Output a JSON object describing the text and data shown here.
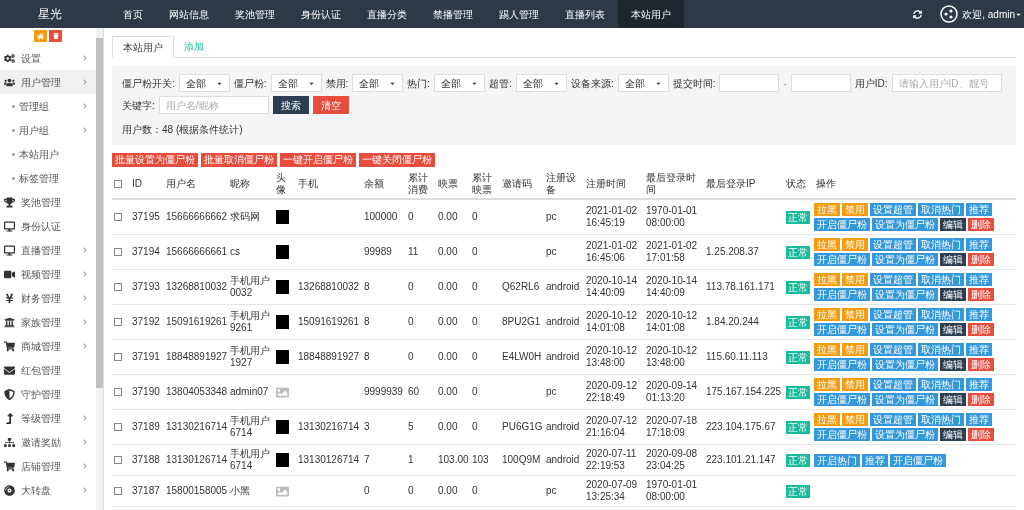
{
  "brand": "星光",
  "nav": [
    {
      "label": "首页",
      "selected": false
    },
    {
      "label": "网站信息",
      "selected": false
    },
    {
      "label": "奖池管理",
      "selected": false
    },
    {
      "label": "身份认证",
      "selected": false
    },
    {
      "label": "直播分类",
      "selected": false
    },
    {
      "label": "禁播管理",
      "selected": false
    },
    {
      "label": "踢人管理",
      "selected": false
    },
    {
      "label": "直播列表",
      "selected": false
    },
    {
      "label": "本站用户",
      "selected": true
    }
  ],
  "user_menu": {
    "label": "欢迎, admin"
  },
  "sidebar": {
    "items": [
      {
        "label": "设置",
        "has_submenu": true,
        "selected": false
      },
      {
        "label": "用户管理",
        "has_submenu": true,
        "selected": true,
        "children": [
          {
            "label": "管理组",
            "has_submenu": true,
            "selected": false
          },
          {
            "label": "用户组",
            "has_submenu": true,
            "selected": false
          },
          {
            "label": "本站用户",
            "has_submenu": false,
            "selected": false
          },
          {
            "label": "标签管理",
            "has_submenu": false,
            "selected": false
          }
        ]
      },
      {
        "label": "奖池管理",
        "has_submenu": false,
        "selected": false
      },
      {
        "label": "身份认证",
        "has_submenu": false,
        "selected": false
      },
      {
        "label": "直播管理",
        "has_submenu": true,
        "selected": false
      },
      {
        "label": "视频管理",
        "has_submenu": true,
        "selected": false
      },
      {
        "label": "财务管理",
        "has_submenu": true,
        "selected": false
      },
      {
        "label": "家族管理",
        "has_submenu": true,
        "selected": false
      },
      {
        "label": "商城管理",
        "has_submenu": true,
        "selected": false
      },
      {
        "label": "红包管理",
        "has_submenu": false,
        "selected": false
      },
      {
        "label": "守护管理",
        "has_submenu": false,
        "selected": false
      },
      {
        "label": "等级管理",
        "has_submenu": true,
        "selected": false
      },
      {
        "label": "邀请奖励",
        "has_submenu": true,
        "selected": false
      },
      {
        "label": "店铺管理",
        "has_submenu": true,
        "selected": false
      },
      {
        "label": "大转盘",
        "has_submenu": true,
        "selected": false
      }
    ]
  },
  "tabs": [
    {
      "label": "本站用户",
      "selected": true
    },
    {
      "label": "添加",
      "selected": false
    }
  ],
  "filters": [
    {
      "kind": "select",
      "label": "僵尸粉开关:",
      "value": "全部"
    },
    {
      "kind": "select",
      "label": "僵尸粉:",
      "value": "全部"
    },
    {
      "kind": "select",
      "label": "禁用:",
      "value": "全部"
    },
    {
      "kind": "select",
      "label": "热门:",
      "value": "全部"
    },
    {
      "kind": "select",
      "label": "超管:",
      "value": "全部"
    },
    {
      "kind": "select",
      "label": "设备来源:",
      "value": "全部"
    },
    {
      "kind": "daterange",
      "label": "提交时间:",
      "separator": "-"
    },
    {
      "kind": "text",
      "label": "用户ID:",
      "placeholder": "请输入用户ID、靓号"
    },
    {
      "kind": "text",
      "label": "关键字:",
      "placeholder": "用户名/昵称"
    }
  ],
  "search_button": "搜索",
  "clear_button": "清空",
  "count_text": "用户数：48 (根据条件统计)",
  "bulk_buttons": [
    "批量设置为僵尸粉",
    "批量取消僵尸粉",
    "一键开启僵尸粉",
    "一键关闭僵尸粉"
  ],
  "table": {
    "select_all_checked": false,
    "columns": [
      "ID",
      "用户名",
      "昵称",
      "头像",
      "手机",
      "余额",
      "累计消费",
      "映票",
      "累计映票",
      "邀请码",
      "注册设备",
      "注册时间",
      "最后登录时间",
      "最后登录IP",
      "状态",
      "操作"
    ],
    "rows": [
      {
        "checked": false,
        "id": "37195",
        "username": "15666666662",
        "nickname": "求码网",
        "avatar": {
          "kind": "image"
        },
        "phone": "",
        "balance": "100000",
        "consumed": "0",
        "tickets": "0.00",
        "total_tickets": "0",
        "invite_code": "",
        "device": "pc",
        "reg_time": "2021-01-02 16:45:19",
        "last_login": "1970-01-01 08:00:00",
        "last_ip": "",
        "status": "正常",
        "actions": [
          {
            "label": "拉黑",
            "kind": "warning"
          },
          {
            "label": "禁用",
            "kind": "warning"
          },
          {
            "label": "设置超管",
            "kind": "info"
          },
          {
            "label": "取消热门",
            "kind": "info"
          },
          {
            "label": "推荐",
            "kind": "info"
          },
          {
            "label": "开启僵尸粉",
            "kind": "info"
          },
          {
            "label": "设置为僵尸粉",
            "kind": "info"
          },
          {
            "label": "编辑",
            "kind": "dark"
          },
          {
            "label": "删除",
            "kind": "danger"
          }
        ]
      },
      {
        "checked": false,
        "id": "37194",
        "username": "15666666661",
        "nickname": "cs",
        "avatar": {
          "kind": "image"
        },
        "phone": "",
        "balance": "99989",
        "consumed": "11",
        "tickets": "0.00",
        "total_tickets": "0",
        "invite_code": "",
        "device": "pc",
        "reg_time": "2021-01-02 16:45:06",
        "last_login": "2021-01-02 17:01:58",
        "last_ip": "1.25.208.37",
        "status": "正常",
        "actions": [
          {
            "label": "拉黑",
            "kind": "warning"
          },
          {
            "label": "禁用",
            "kind": "warning"
          },
          {
            "label": "设置超管",
            "kind": "info"
          },
          {
            "label": "取消热门",
            "kind": "info"
          },
          {
            "label": "推荐",
            "kind": "info"
          },
          {
            "label": "开启僵尸粉",
            "kind": "info"
          },
          {
            "label": "设置为僵尸粉",
            "kind": "info"
          },
          {
            "label": "编辑",
            "kind": "dark"
          },
          {
            "label": "删除",
            "kind": "danger"
          }
        ]
      },
      {
        "checked": false,
        "id": "37193",
        "username": "13268810032",
        "nickname": "手机用户0032",
        "avatar": {
          "kind": "image"
        },
        "phone": "13268810032",
        "balance": "8",
        "consumed": "0",
        "tickets": "0.00",
        "total_tickets": "0",
        "invite_code": "Q62RL6",
        "device": "android",
        "reg_time": "2020-10-14 14:40:09",
        "last_login": "2020-10-14 14:40:09",
        "last_ip": "113.78.161.171",
        "status": "正常",
        "actions": [
          {
            "label": "拉黑",
            "kind": "warning"
          },
          {
            "label": "禁用",
            "kind": "warning"
          },
          {
            "label": "设置超管",
            "kind": "info"
          },
          {
            "label": "取消热门",
            "kind": "info"
          },
          {
            "label": "推荐",
            "kind": "info"
          },
          {
            "label": "开启僵尸粉",
            "kind": "info"
          },
          {
            "label": "设置为僵尸粉",
            "kind": "info"
          },
          {
            "label": "编辑",
            "kind": "dark"
          },
          {
            "label": "删除",
            "kind": "danger"
          }
        ]
      },
      {
        "checked": false,
        "id": "37192",
        "username": "15091619261",
        "nickname": "手机用户9261",
        "avatar": {
          "kind": "image"
        },
        "phone": "15091619261",
        "balance": "8",
        "consumed": "0",
        "tickets": "0.00",
        "total_tickets": "0",
        "invite_code": "8PU2G1",
        "device": "android",
        "reg_time": "2020-10-12 14:01:08",
        "last_login": "2020-10-12 14:01:08",
        "last_ip": "1.84.20.244",
        "status": "正常",
        "actions": [
          {
            "label": "拉黑",
            "kind": "warning"
          },
          {
            "label": "禁用",
            "kind": "warning"
          },
          {
            "label": "设置超管",
            "kind": "info"
          },
          {
            "label": "取消热门",
            "kind": "info"
          },
          {
            "label": "推荐",
            "kind": "info"
          },
          {
            "label": "开启僵尸粉",
            "kind": "info"
          },
          {
            "label": "设置为僵尸粉",
            "kind": "info"
          },
          {
            "label": "编辑",
            "kind": "dark"
          },
          {
            "label": "删除",
            "kind": "danger"
          }
        ]
      },
      {
        "checked": false,
        "id": "37191",
        "username": "18848891927",
        "nickname": "手机用户1927",
        "avatar": {
          "kind": "image"
        },
        "phone": "18848891927",
        "balance": "8",
        "consumed": "0",
        "tickets": "0.00",
        "total_tickets": "0",
        "invite_code": "E4LW0H",
        "device": "android",
        "reg_time": "2020-10-12 13:48:00",
        "last_login": "2020-10-12 13:48:00",
        "last_ip": "115.60.11.113",
        "status": "正常",
        "actions": [
          {
            "label": "拉黑",
            "kind": "warning"
          },
          {
            "label": "禁用",
            "kind": "warning"
          },
          {
            "label": "设置超管",
            "kind": "info"
          },
          {
            "label": "取消热门",
            "kind": "info"
          },
          {
            "label": "推荐",
            "kind": "info"
          },
          {
            "label": "开启僵尸粉",
            "kind": "info"
          },
          {
            "label": "设置为僵尸粉",
            "kind": "info"
          },
          {
            "label": "编辑",
            "kind": "dark"
          },
          {
            "label": "删除",
            "kind": "danger"
          }
        ]
      },
      {
        "checked": false,
        "id": "37190",
        "username": "13804053348",
        "nickname": "admin07",
        "avatar": {
          "kind": "broken"
        },
        "phone": "",
        "balance": "9999939",
        "consumed": "60",
        "tickets": "0.00",
        "total_tickets": "0",
        "invite_code": "",
        "device": "pc",
        "reg_time": "2020-09-12 22:18:49",
        "last_login": "2020-09-14 01:13:20",
        "last_ip": "175.167.154.225",
        "status": "正常",
        "actions": [
          {
            "label": "拉黑",
            "kind": "warning"
          },
          {
            "label": "禁用",
            "kind": "warning"
          },
          {
            "label": "设置超管",
            "kind": "info"
          },
          {
            "label": "取消热门",
            "kind": "info"
          },
          {
            "label": "推荐",
            "kind": "info"
          },
          {
            "label": "开启僵尸粉",
            "kind": "info"
          },
          {
            "label": "设置为僵尸粉",
            "kind": "info"
          },
          {
            "label": "编辑",
            "kind": "dark"
          },
          {
            "label": "删除",
            "kind": "danger"
          }
        ]
      },
      {
        "checked": false,
        "id": "37189",
        "username": "13130216714",
        "nickname": "手机用户6714",
        "avatar": {
          "kind": "image"
        },
        "phone": "13130216714",
        "balance": "3",
        "consumed": "5",
        "tickets": "0.00",
        "total_tickets": "0",
        "invite_code": "PU6G1G",
        "device": "android",
        "reg_time": "2020-07-12 21:16:04",
        "last_login": "2020-07-18 17:18:09",
        "last_ip": "223.104.175.67",
        "status": "正常",
        "actions": [
          {
            "label": "拉黑",
            "kind": "warning"
          },
          {
            "label": "禁用",
            "kind": "warning"
          },
          {
            "label": "设置超管",
            "kind": "info"
          },
          {
            "label": "取消热门",
            "kind": "info"
          },
          {
            "label": "推荐",
            "kind": "info"
          },
          {
            "label": "开启僵尸粉",
            "kind": "info"
          },
          {
            "label": "设置为僵尸粉",
            "kind": "info"
          },
          {
            "label": "编辑",
            "kind": "dark"
          },
          {
            "label": "删除",
            "kind": "danger"
          }
        ]
      },
      {
        "checked": false,
        "id": "37188",
        "username": "13130126714",
        "nickname": "手机用户6714",
        "avatar": {
          "kind": "image"
        },
        "phone": "13130126714",
        "balance": "7",
        "consumed": "1",
        "tickets": "103.00",
        "total_tickets": "103",
        "invite_code": "100Q9M",
        "device": "android",
        "reg_time": "2020-07-11 22:19:53",
        "last_login": "2020-09-08 23:04:25",
        "last_ip": "223.101.21.147",
        "status": "正常",
        "actions": [
          {
            "label": "开启热门",
            "kind": "info"
          },
          {
            "label": "推荐",
            "kind": "info"
          },
          {
            "label": "开启僵尸粉",
            "kind": "info"
          }
        ]
      },
      {
        "checked": false,
        "id": "37187",
        "username": "15800158005",
        "nickname": "小黑",
        "avatar": {
          "kind": "broken"
        },
        "phone": "",
        "balance": "0",
        "consumed": "0",
        "tickets": "0.00",
        "total_tickets": "0",
        "invite_code": "",
        "device": "pc",
        "reg_time": "2020-07-09 13:25:34",
        "last_login": "1970-01-01 08:00:00",
        "last_ip": "",
        "status": "正常",
        "actions": []
      }
    ]
  }
}
